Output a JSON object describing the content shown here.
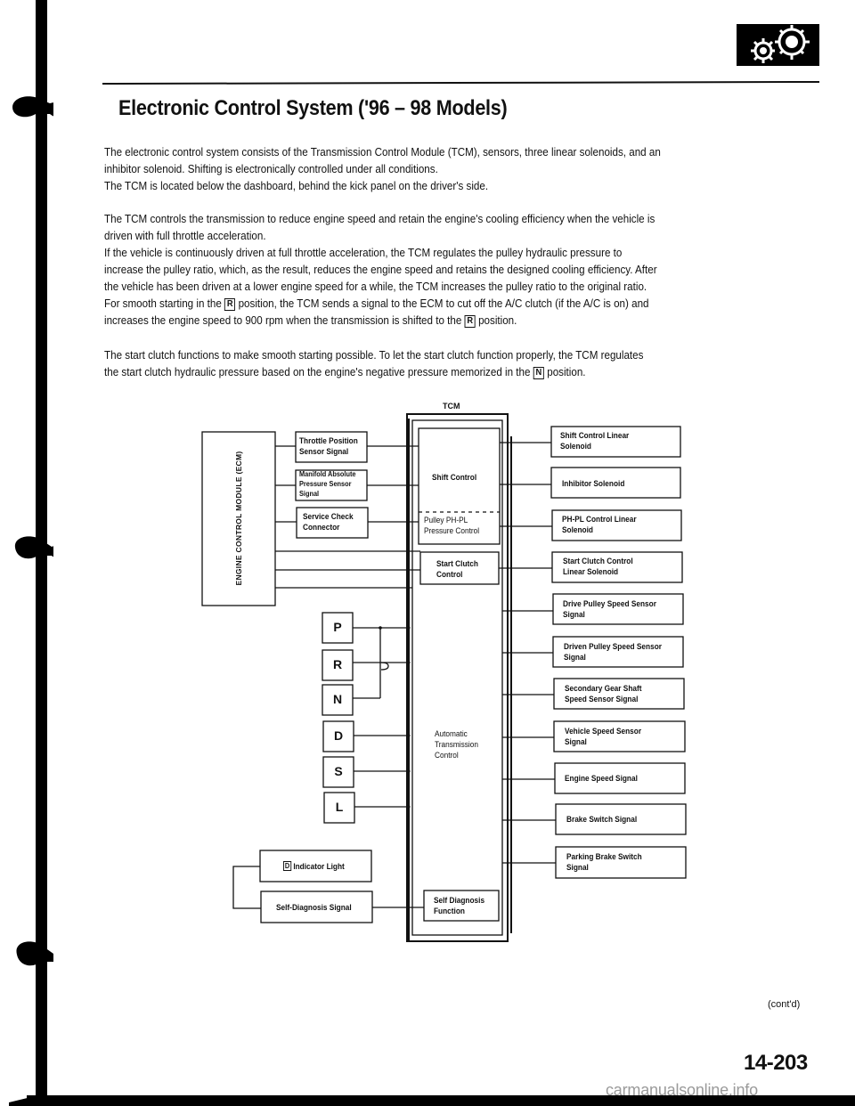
{
  "header": {
    "icon": "gears-icon",
    "title": "Electronic Control System ('96 – 98 Models)"
  },
  "paragraphs": [
    {
      "lines": [
        "The electronic control system consists of the Transmission Control Module (TCM), sensors, three linear solenoids, and an",
        "inhibitor solenoid. Shifting is electronically controlled under all conditions.",
        "The TCM is located below the dashboard, behind the kick panel on the driver's side."
      ]
    },
    {
      "lines": [
        "The TCM controls the transmission to reduce engine speed and retain the engine's cooling efficiency when the vehicle is",
        "driven with full throttle acceleration.",
        "If the vehicle is continuously driven at full throttle acceleration, the TCM regulates the pulley hydraulic pressure to",
        "increase the pulley ratio, which, as the result, reduces the engine speed and retains the designed cooling efficiency. After",
        "the vehicle has been driven at a lower engine speed for a while, the TCM increases the pulley ratio to the original ratio."
      ],
      "line6_pre": "For smooth starting in the ",
      "line6_box": "R",
      "line6_post": " position, the TCM sends a signal to the ECM to cut off the A/C clutch (if the A/C is on) and",
      "line7_pre": "increases the engine speed to 900 rpm when the transmission is shifted to the ",
      "line7_box": "R",
      "line7_post": " position."
    },
    {
      "line1": "The start clutch functions to make smooth starting possible. To let the start clutch function properly, the TCM regulates",
      "line2_pre": "the start clutch hydraulic pressure based on the engine's negative pressure memorized in the ",
      "line2_box": "N",
      "line2_post": " position."
    }
  ],
  "diagram": {
    "tcm_title": "TCM",
    "ecm_label": "ENGINE CONTROL MODULE (ECM)",
    "ecm_inputs": [
      [
        "Throttle Position",
        "Sensor Signal"
      ],
      [
        "Manifold Absolute",
        "Pressure Sensor",
        "Signal"
      ],
      [
        "Service Check",
        "Connector"
      ]
    ],
    "tcm_blocks": {
      "shift_control": "Shift Control",
      "pulley_control": [
        "Pulley PH-PL",
        "Pressure Control"
      ],
      "start_clutch": [
        "Start Clutch",
        "Control"
      ],
      "atc": [
        "Automatic",
        "Transmission",
        "Control"
      ],
      "self_diag": [
        "Self Diagnosis",
        "Function"
      ]
    },
    "positions": [
      "P",
      "R",
      "N",
      "D",
      "S",
      "L"
    ],
    "left_bottom": {
      "indicator_box": "D",
      "indicator_text": "Indicator Light",
      "self_diag_signal": "Self-Diagnosis Signal"
    },
    "right_items": [
      [
        "Shift Control Linear",
        "Solenoid"
      ],
      [
        "Inhibitor Solenoid"
      ],
      [
        "PH-PL Control Linear",
        "Solenoid"
      ],
      [
        "Start Clutch Control",
        "Linear Solenoid"
      ],
      [
        "Drive Pulley Speed Sensor",
        "Signal"
      ],
      [
        "Driven Pulley Speed Sensor",
        "Signal"
      ],
      [
        "Secondary Gear Shaft",
        "Speed Sensor Signal"
      ],
      [
        "Vehicle Speed Sensor",
        "Signal"
      ],
      [
        "Engine Speed Signal"
      ],
      [
        "Brake Switch Signal"
      ],
      [
        "Parking Brake Switch",
        "Signal"
      ]
    ]
  },
  "footer": {
    "contd": "(cont'd)",
    "page_number": "14-203",
    "watermark": "carmanualsonline.info"
  }
}
